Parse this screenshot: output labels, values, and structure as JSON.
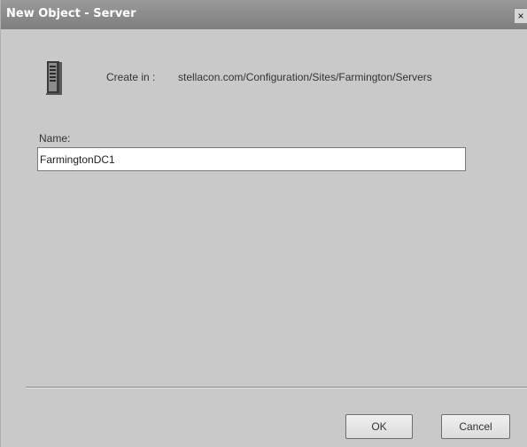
{
  "window": {
    "title": "New Object - Server",
    "close_glyph": "×"
  },
  "header": {
    "icon": "server-icon",
    "create_in_label": "Create in :",
    "create_in_path": "stellacon.com/Configuration/Sites/Farmington/Servers"
  },
  "form": {
    "name_label": "Name:",
    "name_value": "FarmingtonDC1"
  },
  "buttons": {
    "ok_label": "OK",
    "cancel_label": "Cancel"
  }
}
